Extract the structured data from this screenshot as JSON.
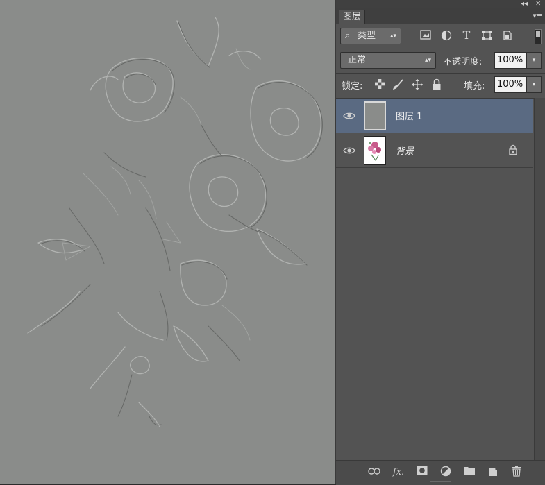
{
  "panel": {
    "collapse_glyph": "◂◂",
    "close_glyph": "✕",
    "tab_title": "图层",
    "menu_glyph": "▾≡"
  },
  "filter": {
    "kind_label": "类型",
    "search_glyph": "⌕",
    "icons": [
      "image-filter-icon",
      "adjustment-filter-icon",
      "type-filter-icon",
      "shape-filter-icon",
      "smart-object-filter-icon"
    ]
  },
  "blend": {
    "mode": "正常",
    "opacity_label": "不透明度:",
    "opacity_value": "100%"
  },
  "lock": {
    "label": "锁定:",
    "fill_label": "填充:",
    "fill_value": "100%"
  },
  "layers": [
    {
      "name": "图层 1",
      "selected": true,
      "visible": true,
      "locked": false
    },
    {
      "name": "背景",
      "selected": false,
      "visible": true,
      "locked": true
    }
  ],
  "bottom_icons": [
    "link-layers-icon",
    "fx-icon",
    "layer-mask-icon",
    "adjustment-layer-icon",
    "group-folder-icon",
    "new-layer-icon",
    "trash-icon"
  ],
  "fx_label": "fx.",
  "colors": {
    "canvas_bg": "#8a8c8a",
    "panel_bg": "#535353",
    "selected_layer": "#5a6a82"
  }
}
